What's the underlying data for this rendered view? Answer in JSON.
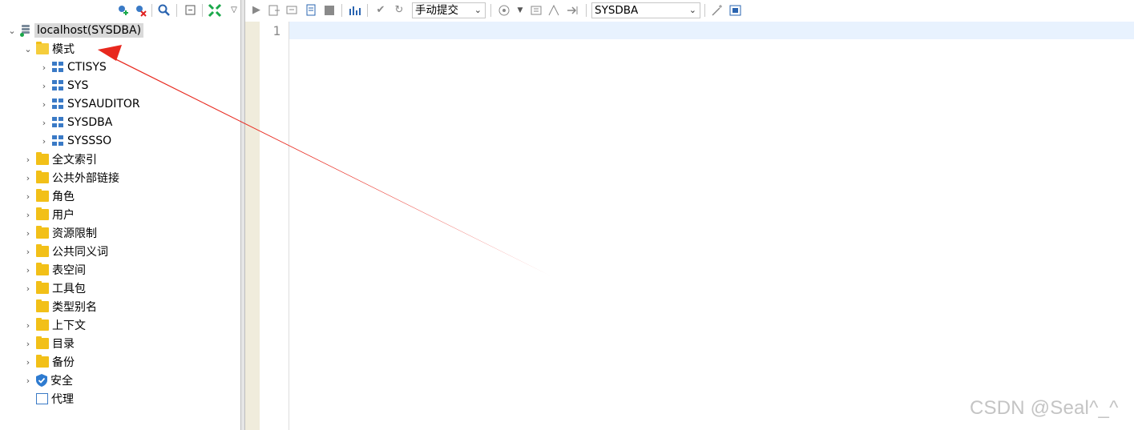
{
  "tree": {
    "root": {
      "label": "localhost(SYSDBA)"
    },
    "schema_folder": {
      "label": "模式"
    },
    "schemas": [
      {
        "label": "CTISYS"
      },
      {
        "label": "SYS"
      },
      {
        "label": "SYSAUDITOR"
      },
      {
        "label": "SYSDBA"
      },
      {
        "label": "SYSSSO"
      }
    ],
    "folders": [
      {
        "label": "全文索引"
      },
      {
        "label": "公共外部链接"
      },
      {
        "label": "角色"
      },
      {
        "label": "用户"
      },
      {
        "label": "资源限制"
      },
      {
        "label": "公共同义词"
      },
      {
        "label": "表空间"
      },
      {
        "label": "工具包"
      },
      {
        "label": "类型别名"
      },
      {
        "label": "上下文"
      },
      {
        "label": "目录"
      },
      {
        "label": "备份"
      }
    ],
    "security": {
      "label": "安全"
    },
    "proxy": {
      "label": "代理"
    }
  },
  "editor_toolbar": {
    "commit_mode": "手动提交",
    "schema_select": "SYSDBA"
  },
  "editor": {
    "line_numbers": [
      "1"
    ]
  },
  "watermark": "CSDN @Seal^_^",
  "colors": {
    "folder": "#f2c018",
    "schema_icon": "#3a7ac6",
    "annotation_arrow": "#e8281e",
    "current_line": "#e8f2fe"
  }
}
